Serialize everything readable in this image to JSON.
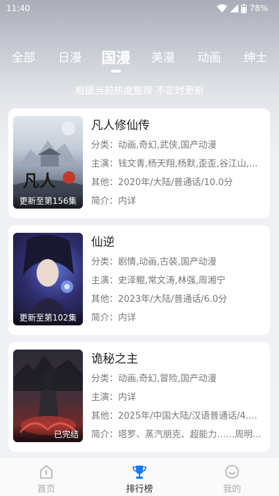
{
  "status_bar": {
    "time": "11:40",
    "battery": "78%"
  },
  "tabs": [
    {
      "label": "全部",
      "active": false
    },
    {
      "label": "日漫",
      "active": false
    },
    {
      "label": "国漫",
      "active": true
    },
    {
      "label": "美漫",
      "active": false
    },
    {
      "label": "动画",
      "active": false
    },
    {
      "label": "绅士",
      "active": false
    }
  ],
  "subtitle": "根据当前热度整理 不定时更新",
  "items": [
    {
      "title": "凡人修仙传",
      "genre": "分类：动画,奇幻,武侠,国产动漫",
      "cast": "主演：钱文青,杨天翔,杨默,歪歪,谷江山,...",
      "other": "其他：2020年/大陆/普通话/10.0分",
      "intro": "简介：内详",
      "badge": "更新至第156集",
      "poster_art": "凡人"
    },
    {
      "title": "仙逆",
      "genre": "分类：剧情,动画,古装,国产动漫",
      "cast": "主演：史泽鲲,常文涛,林强,周湘宁",
      "other": "其他：2023年/大陆/普通话/6.0分",
      "intro": "简介：内详",
      "badge": "更新至第102集"
    },
    {
      "title": "诡秘之主",
      "genre": "分类：动画,奇幻,冒险,国产动漫",
      "cast": "主演：内详",
      "other": "其他：2025年/中国大陆/汉语普通话/4.9...",
      "intro": "简介：塔罗、蒸汽朋克、超能力……周明...",
      "badge": "已完结"
    }
  ],
  "bottom_nav": [
    {
      "label": "首页",
      "icon": "home-icon",
      "active": false
    },
    {
      "label": "排行榜",
      "icon": "trophy-icon",
      "active": true
    },
    {
      "label": "我的",
      "icon": "profile-smile-icon",
      "active": false
    }
  ],
  "colors": {
    "active_nav": "#1677ff",
    "inactive_nav": "#aaaaaa"
  }
}
